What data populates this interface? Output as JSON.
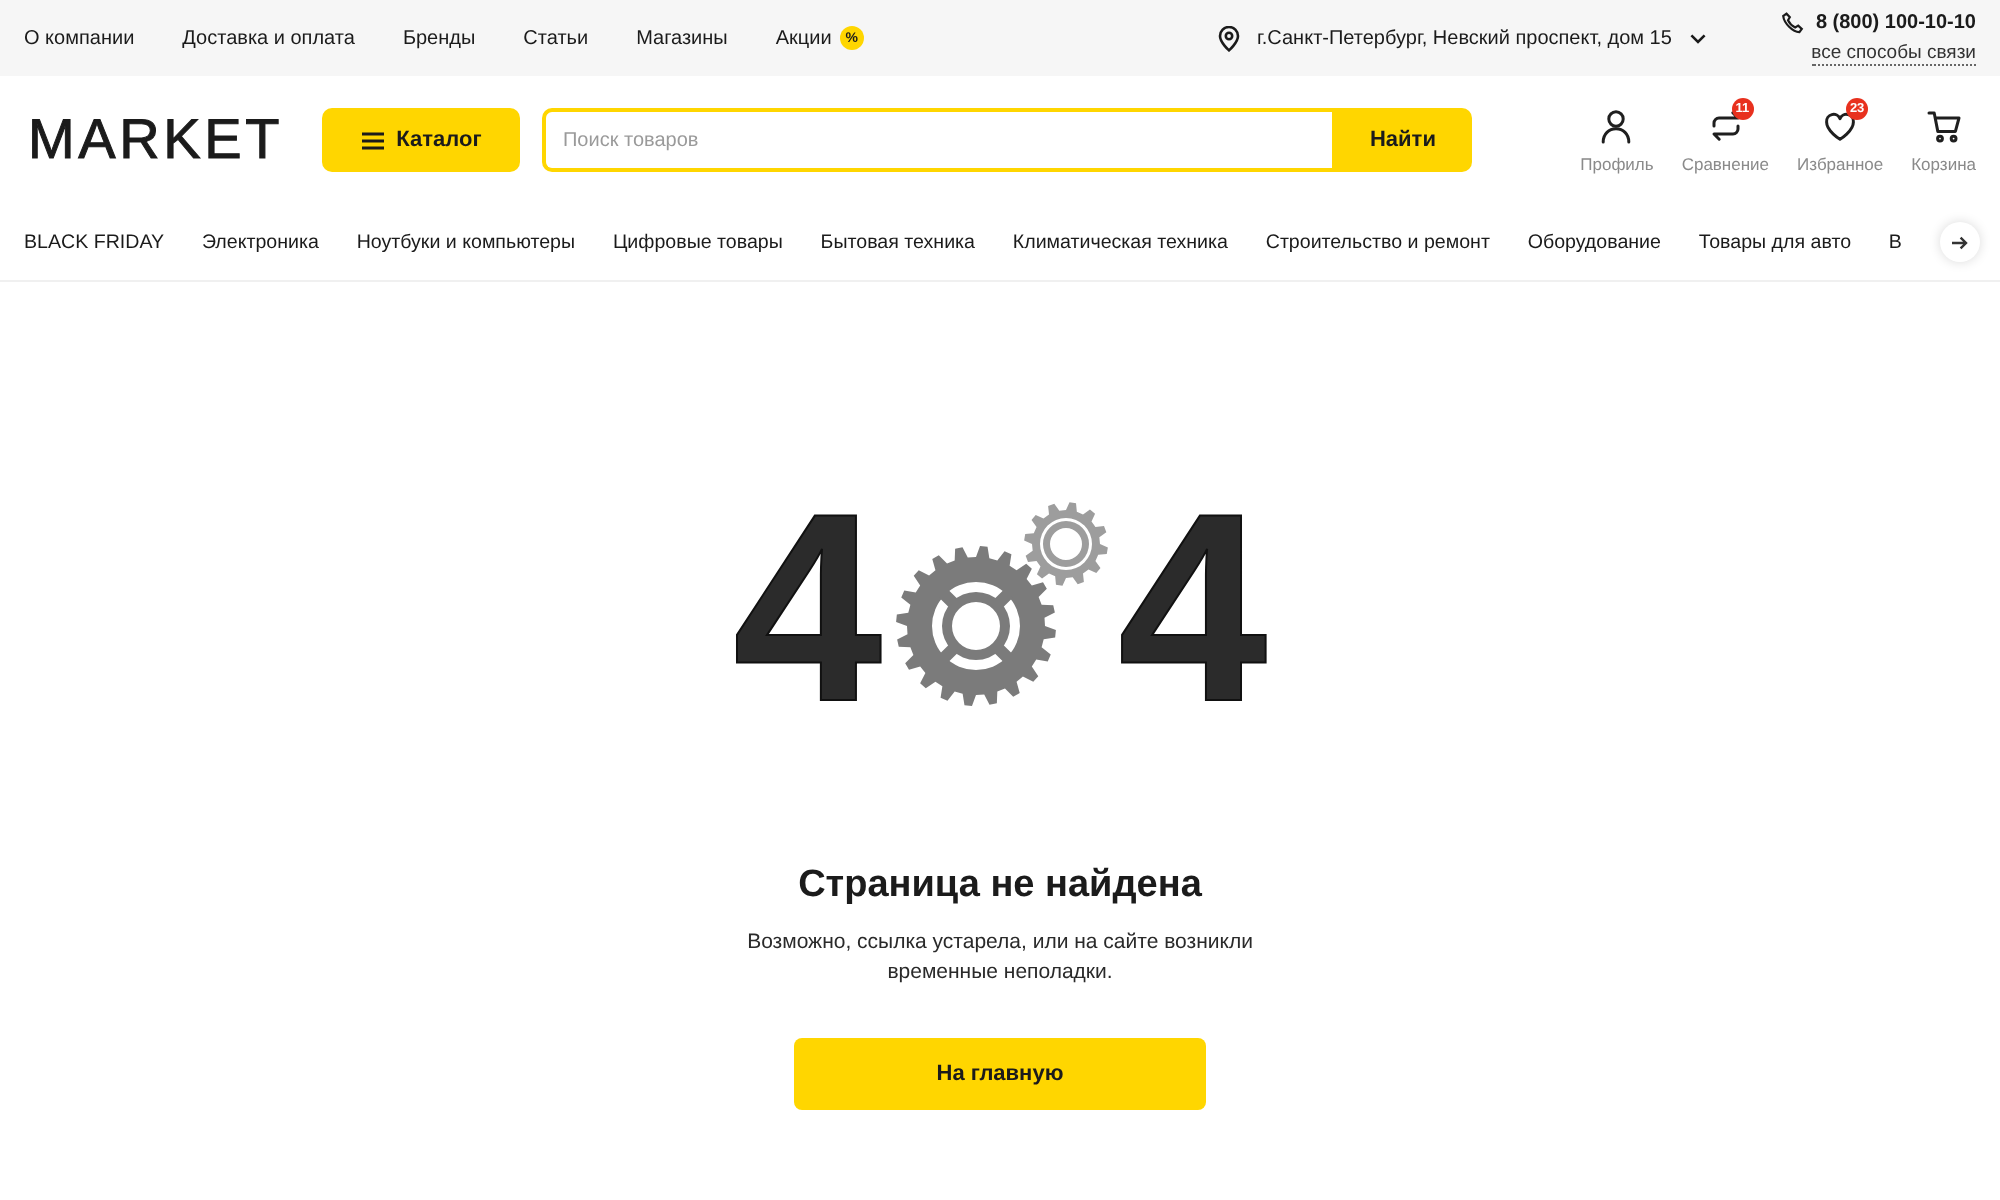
{
  "top_bar": {
    "links": [
      {
        "label": "О компании"
      },
      {
        "label": "Доставка и оплата"
      },
      {
        "label": "Бренды"
      },
      {
        "label": "Статьи"
      },
      {
        "label": "Магазины"
      },
      {
        "label": "Акции",
        "badge": "%"
      }
    ],
    "location": "г.Санкт-Петербург, Невский проспект, дом 15",
    "phone": "8 (800) 100-10-10",
    "contacts_link": "все способы связи"
  },
  "header": {
    "logo": "MARKET",
    "catalog_button": "Каталог",
    "search": {
      "placeholder": "Поиск товаров",
      "button": "Найти"
    },
    "actions": [
      {
        "kind": "profile",
        "label": "Профиль"
      },
      {
        "kind": "compare",
        "label": "Сравнение",
        "badge": "11"
      },
      {
        "kind": "favorites",
        "label": "Избранное",
        "badge": "23"
      },
      {
        "kind": "cart",
        "label": "Корзина"
      }
    ]
  },
  "category_nav": {
    "items": [
      "BLACK FRIDAY",
      "Электроника",
      "Ноутбуки и компьютеры",
      "Цифровые товары",
      "Бытовая техника",
      "Климатическая техника",
      "Строительство и ремонт",
      "Оборудование",
      "Товары для авто",
      "В"
    ]
  },
  "error_page": {
    "digits": [
      "4",
      "4"
    ],
    "title": "Страница не найдена",
    "message": "Возможно, ссылка устарела, или на сайте возникли временные неполадки.",
    "button": "На главную"
  }
}
